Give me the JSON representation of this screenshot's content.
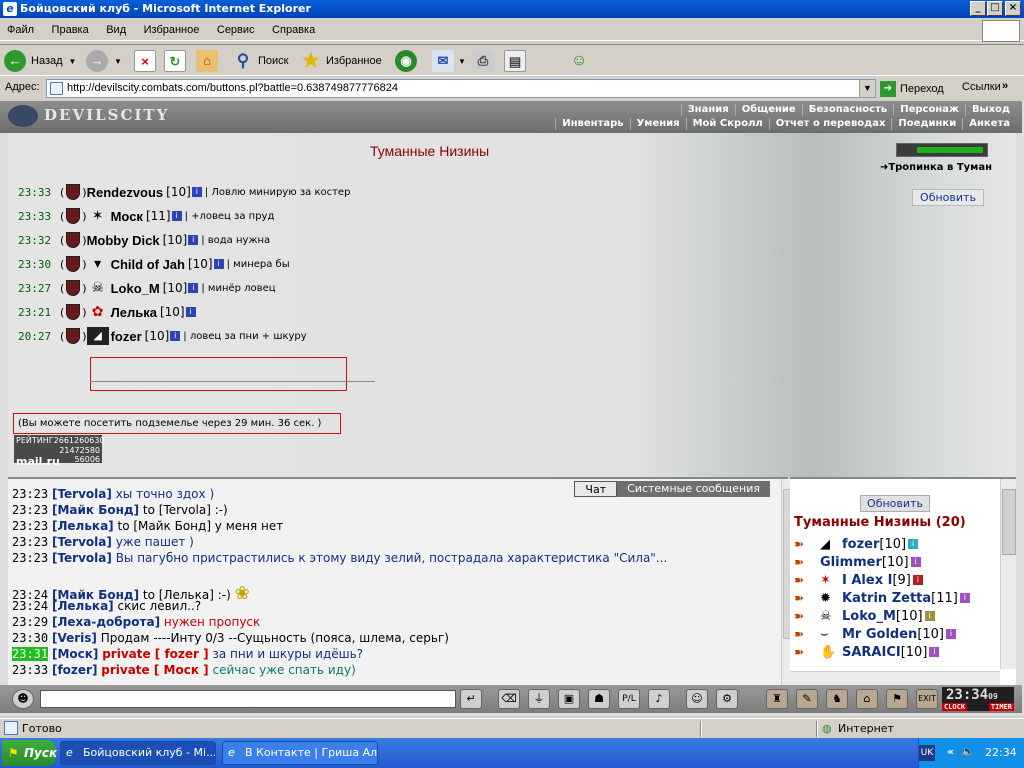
{
  "window": {
    "title": "Бойцовский клуб - Microsoft Internet Explorer"
  },
  "menu": [
    "Файл",
    "Правка",
    "Вид",
    "Избранное",
    "Сервис",
    "Справка"
  ],
  "toolbar": {
    "back": "Назад",
    "search": "Поиск",
    "favorites": "Избранное"
  },
  "address": {
    "label": "Адрес:",
    "url": "http://devilscity.combats.com/buttons.pl?battle=0.638749877776824",
    "go": "Переход",
    "links": "Ссылки"
  },
  "game": {
    "logo": "DEVILSCITY",
    "nav_top": [
      "Знания",
      "Общение",
      "Безопасность",
      "Персонаж",
      "Выход"
    ],
    "nav_bottom": [
      "Инвентарь",
      "Умения",
      "Мой Скролл",
      "Отчет о переводах",
      "Поединки",
      "Анкета"
    ],
    "room_title": "Туманные Низины",
    "tunnel_link": "Тропинка в Туман",
    "refresh": "Обновить",
    "entries": [
      {
        "time": "23:33",
        "name": "Rendezvous",
        "level": "[10]",
        "status": "| Ловлю минирую за костер"
      },
      {
        "time": "23:33",
        "name": "Моск",
        "level": "[11]",
        "status": "| +ловец за пруд"
      },
      {
        "time": "23:32",
        "name": "Mobby Dick",
        "level": "[10]",
        "status": "| вода нужна"
      },
      {
        "time": "23:30",
        "name": "Child of Jah",
        "level": "[10]",
        "status": "| минера бы"
      },
      {
        "time": "23:27",
        "name": "Loko_M",
        "level": "[10]",
        "status": "| минёр ловец"
      },
      {
        "time": "23:21",
        "name": "Лелька",
        "level": "[10]",
        "status": ""
      },
      {
        "time": "20:27",
        "name": "fozer",
        "level": "[10]",
        "status": "| ловец за пни + шкуру"
      }
    ],
    "notice": "(Вы можете посетить подземелье через 29 мин. 36 сек. )",
    "counter": {
      "label": "РЕЙТИНГ",
      "v1": "2661260630",
      "v2": "21472580",
      "v3": "56006",
      "brand": "mail.ru"
    }
  },
  "chat": {
    "tabs": {
      "chat": "Чат",
      "system": "Системные сообщения"
    },
    "messages": [
      {
        "time": "23:23",
        "user": "[Tervola]",
        "text": "хы точно здох )",
        "color": "blue"
      },
      {
        "time": "23:23",
        "user": "[Майк Бонд]",
        "text": "to [Tervola] :-)",
        "color": "black"
      },
      {
        "time": "23:23",
        "user": "[Лелька]",
        "text": "to [Майк Бонд] у меня нет",
        "color": "black"
      },
      {
        "time": "23:23",
        "user": "[Tervola]",
        "text": "уже пашет )",
        "color": "blue"
      },
      {
        "time": "23:23",
        "user": "[Tervola]",
        "text": "Вы пагубно пристрастились к этому виду зелий, пострадала характеристика \"Сила\"...",
        "color": "blue"
      },
      {
        "time": "23:24",
        "user": "[Майк Бонд]",
        "text": "to [Лелька] :-)",
        "color": "black"
      },
      {
        "time": "23:24",
        "user": "[Лелька]",
        "text": "скис левил..?",
        "color": "black"
      },
      {
        "time": "23:29",
        "user": "[Леха-доброта]",
        "text": "нужен пропуск",
        "color": "red"
      },
      {
        "time": "23:30",
        "user": "[Veris]",
        "text": "Продам ----Инту 0/3 --Сущьность (пояса, шлема, серьг)",
        "color": "black"
      },
      {
        "time": "23:31",
        "user": "[Моск]",
        "private": "private [ fozer ]",
        "text": "за пни и шкуры идёшь?",
        "color": "blue"
      },
      {
        "time": "23:33",
        "user": "[fozer]",
        "private": "private [ Моск ]",
        "text": "сейчас уже спать иду)",
        "color": "teal"
      }
    ]
  },
  "users": {
    "refresh": "Обновить",
    "title": "Туманные Низины (20)",
    "list": [
      {
        "name": "fozer",
        "level": "[10]"
      },
      {
        "name": "Glimmer",
        "level": "[10]"
      },
      {
        "name": "I Alex I",
        "level": "[9]"
      },
      {
        "name": "Katrin Zetta",
        "level": "[11]"
      },
      {
        "name": "Loko_M",
        "level": "[10]"
      },
      {
        "name": "Mr Golden",
        "level": "[10]"
      },
      {
        "name": "SARAICI",
        "level": "[10]"
      }
    ]
  },
  "clock": {
    "time": "23:34",
    "sec": "09",
    "clock_label": "CLOCK",
    "timer_label": "TIMER"
  },
  "status": {
    "text": "Готово",
    "zone": "Интернет"
  },
  "taskbar": {
    "start": "Пуск",
    "tasks": [
      "Бойцовский клуб - Mi...",
      "В Контакте | Гриша Ал..."
    ],
    "lang": "UK",
    "time": "22:34"
  },
  "colors": {
    "accent": "#0a5fd8",
    "room_title": "#8b0000",
    "user_blue": "#103080",
    "private_red": "#cc0000",
    "highlight_time": "#1ebe1e"
  }
}
